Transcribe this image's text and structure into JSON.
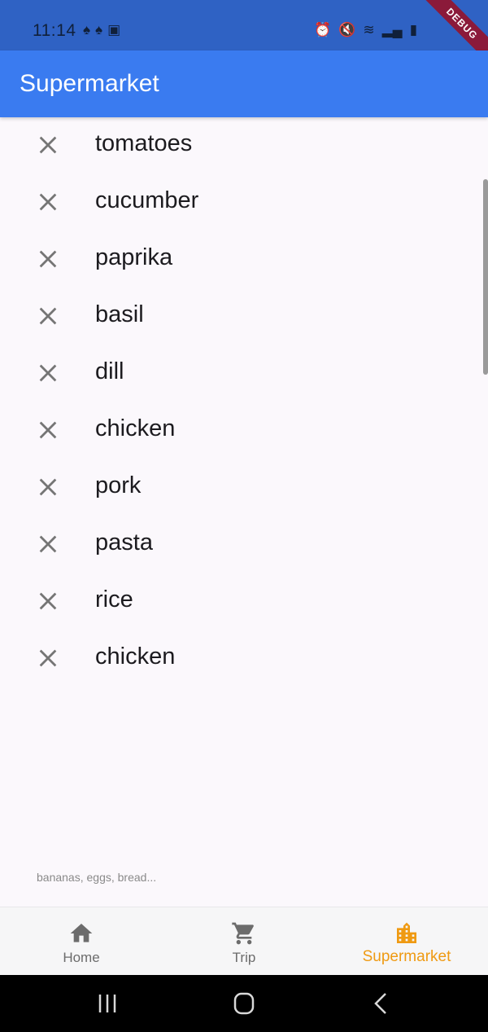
{
  "status_bar": {
    "time": "11:14"
  },
  "debug_banner": "DEBUG",
  "app_bar": {
    "title": "Supermarket"
  },
  "list": {
    "items": [
      {
        "label": "tomatoes"
      },
      {
        "label": "cucumber"
      },
      {
        "label": "paprika"
      },
      {
        "label": "basil"
      },
      {
        "label": "dill"
      },
      {
        "label": "chicken"
      },
      {
        "label": "pork"
      },
      {
        "label": "pasta"
      },
      {
        "label": "rice"
      },
      {
        "label": "chicken"
      }
    ]
  },
  "input_hint": "bananas, eggs, bread...",
  "bottom_nav": {
    "items": [
      {
        "label": "Home",
        "icon": "home-icon"
      },
      {
        "label": "Trip",
        "icon": "cart-icon"
      },
      {
        "label": "Supermarket",
        "icon": "store-building-icon"
      }
    ],
    "active_index": 2
  },
  "colors": {
    "app_bar": "#3a7bf0",
    "status_bar": "#2f62c4",
    "active_nav": "#ef9a12",
    "inactive_nav": "#6c6c6c",
    "debug_ribbon": "#8b1a3a"
  }
}
